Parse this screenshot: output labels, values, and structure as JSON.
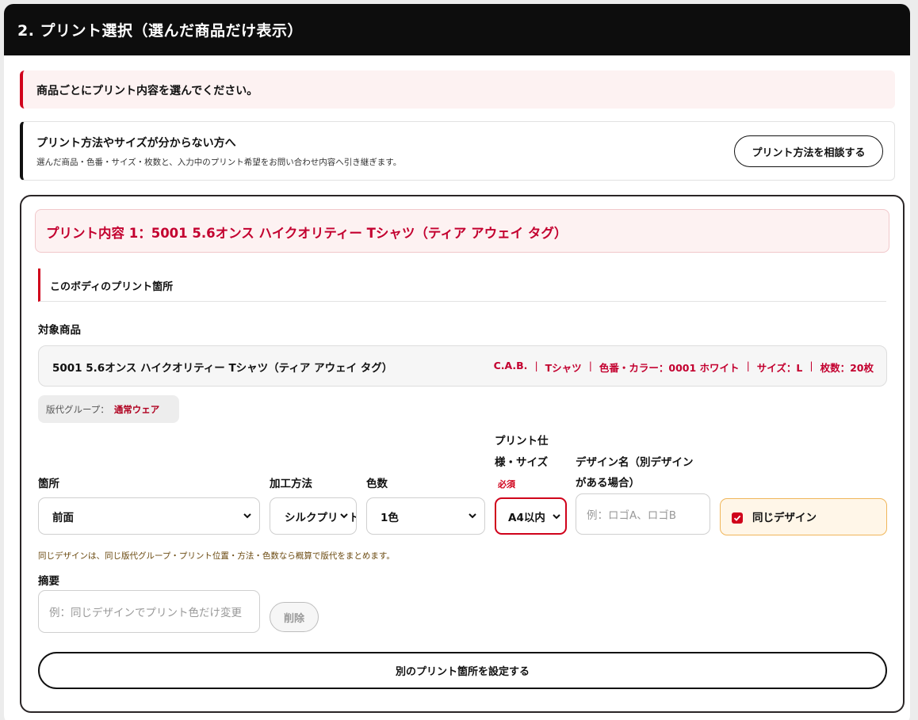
{
  "panel": {
    "title": "2. プリント選択（選んだ商品だけ表示）"
  },
  "notice": {
    "text": "商品ごとにプリント内容を選んでください。"
  },
  "consult": {
    "title": "プリント方法やサイズが分からない方へ",
    "description": "選んだ商品・色番・サイズ・枚数と、入力中のプリント希望をお問い合わせ内容へ引き継ぎます。",
    "button_label": "プリント方法を相談する"
  },
  "print_item": {
    "heading": "プリント内容 1：5001 5.6オンス ハイクオリティー Tシャツ（ティア アウェイ タグ）",
    "section_label": "このボディのプリント箇所",
    "target_label": "対象商品",
    "product": {
      "name": "5001 5.6オンス ハイクオリティー Tシャツ（ティア アウェイ タグ）",
      "meta": [
        "C.A.B.",
        "Tシャツ",
        "色番・カラー：0001 ホワイト",
        "サイズ：L",
        "枚数：20枚"
      ]
    },
    "group": {
      "label": "版代グループ：",
      "value": "通常ウェア"
    },
    "fields": {
      "location": {
        "label": "箇所",
        "value": "前面"
      },
      "method": {
        "label": "加工方法",
        "value": "シルクプリント"
      },
      "colors": {
        "label": "色数",
        "value": "1色"
      },
      "spec": {
        "label_line1": "プリント仕",
        "label_line2": "様・サイズ",
        "required": "必須",
        "value": "A4以内"
      },
      "design_name": {
        "label_line1": "デザイン名（別デザイン",
        "label_line2": "がある場合）",
        "placeholder": "例：ロゴA、ロゴB"
      },
      "same_design": {
        "label": "同じデザイン",
        "checked": true
      }
    },
    "hint": "同じデザインは、同じ版代グループ・プリント位置・方法・色数なら概算で版代をまとめます。",
    "summary": {
      "label": "摘要",
      "placeholder": "例：同じデザインでプリント色だけ変更"
    },
    "delete_label": "削除",
    "add_button_label": "別のプリント箇所を設定する"
  },
  "colors": {
    "accent_red": "#d0021b",
    "heading_red": "#c3002f",
    "header_black": "#0d0d0d",
    "same_design_bg": "#fff6e8",
    "same_design_border": "#f0b65a"
  }
}
